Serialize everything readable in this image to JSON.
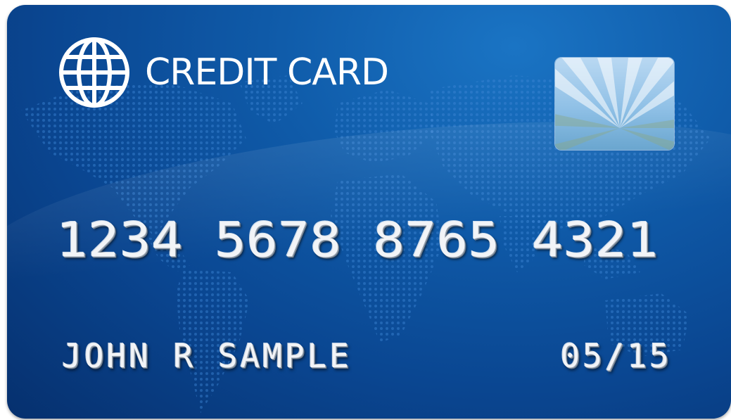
{
  "card": {
    "title": "CREDIT CARD",
    "number": "1234 5678 8765 4321",
    "cardholder": "JOHN R SAMPLE",
    "expiry": "05/15"
  },
  "icons": {
    "logo": "globe-icon",
    "chip": "chip-icon",
    "background": "world-map-dots"
  },
  "colors": {
    "card_blue": "#0a4691",
    "card_blue_light": "#1a74c4",
    "text": "#ffffff",
    "embossed": "#f2f4f7"
  }
}
